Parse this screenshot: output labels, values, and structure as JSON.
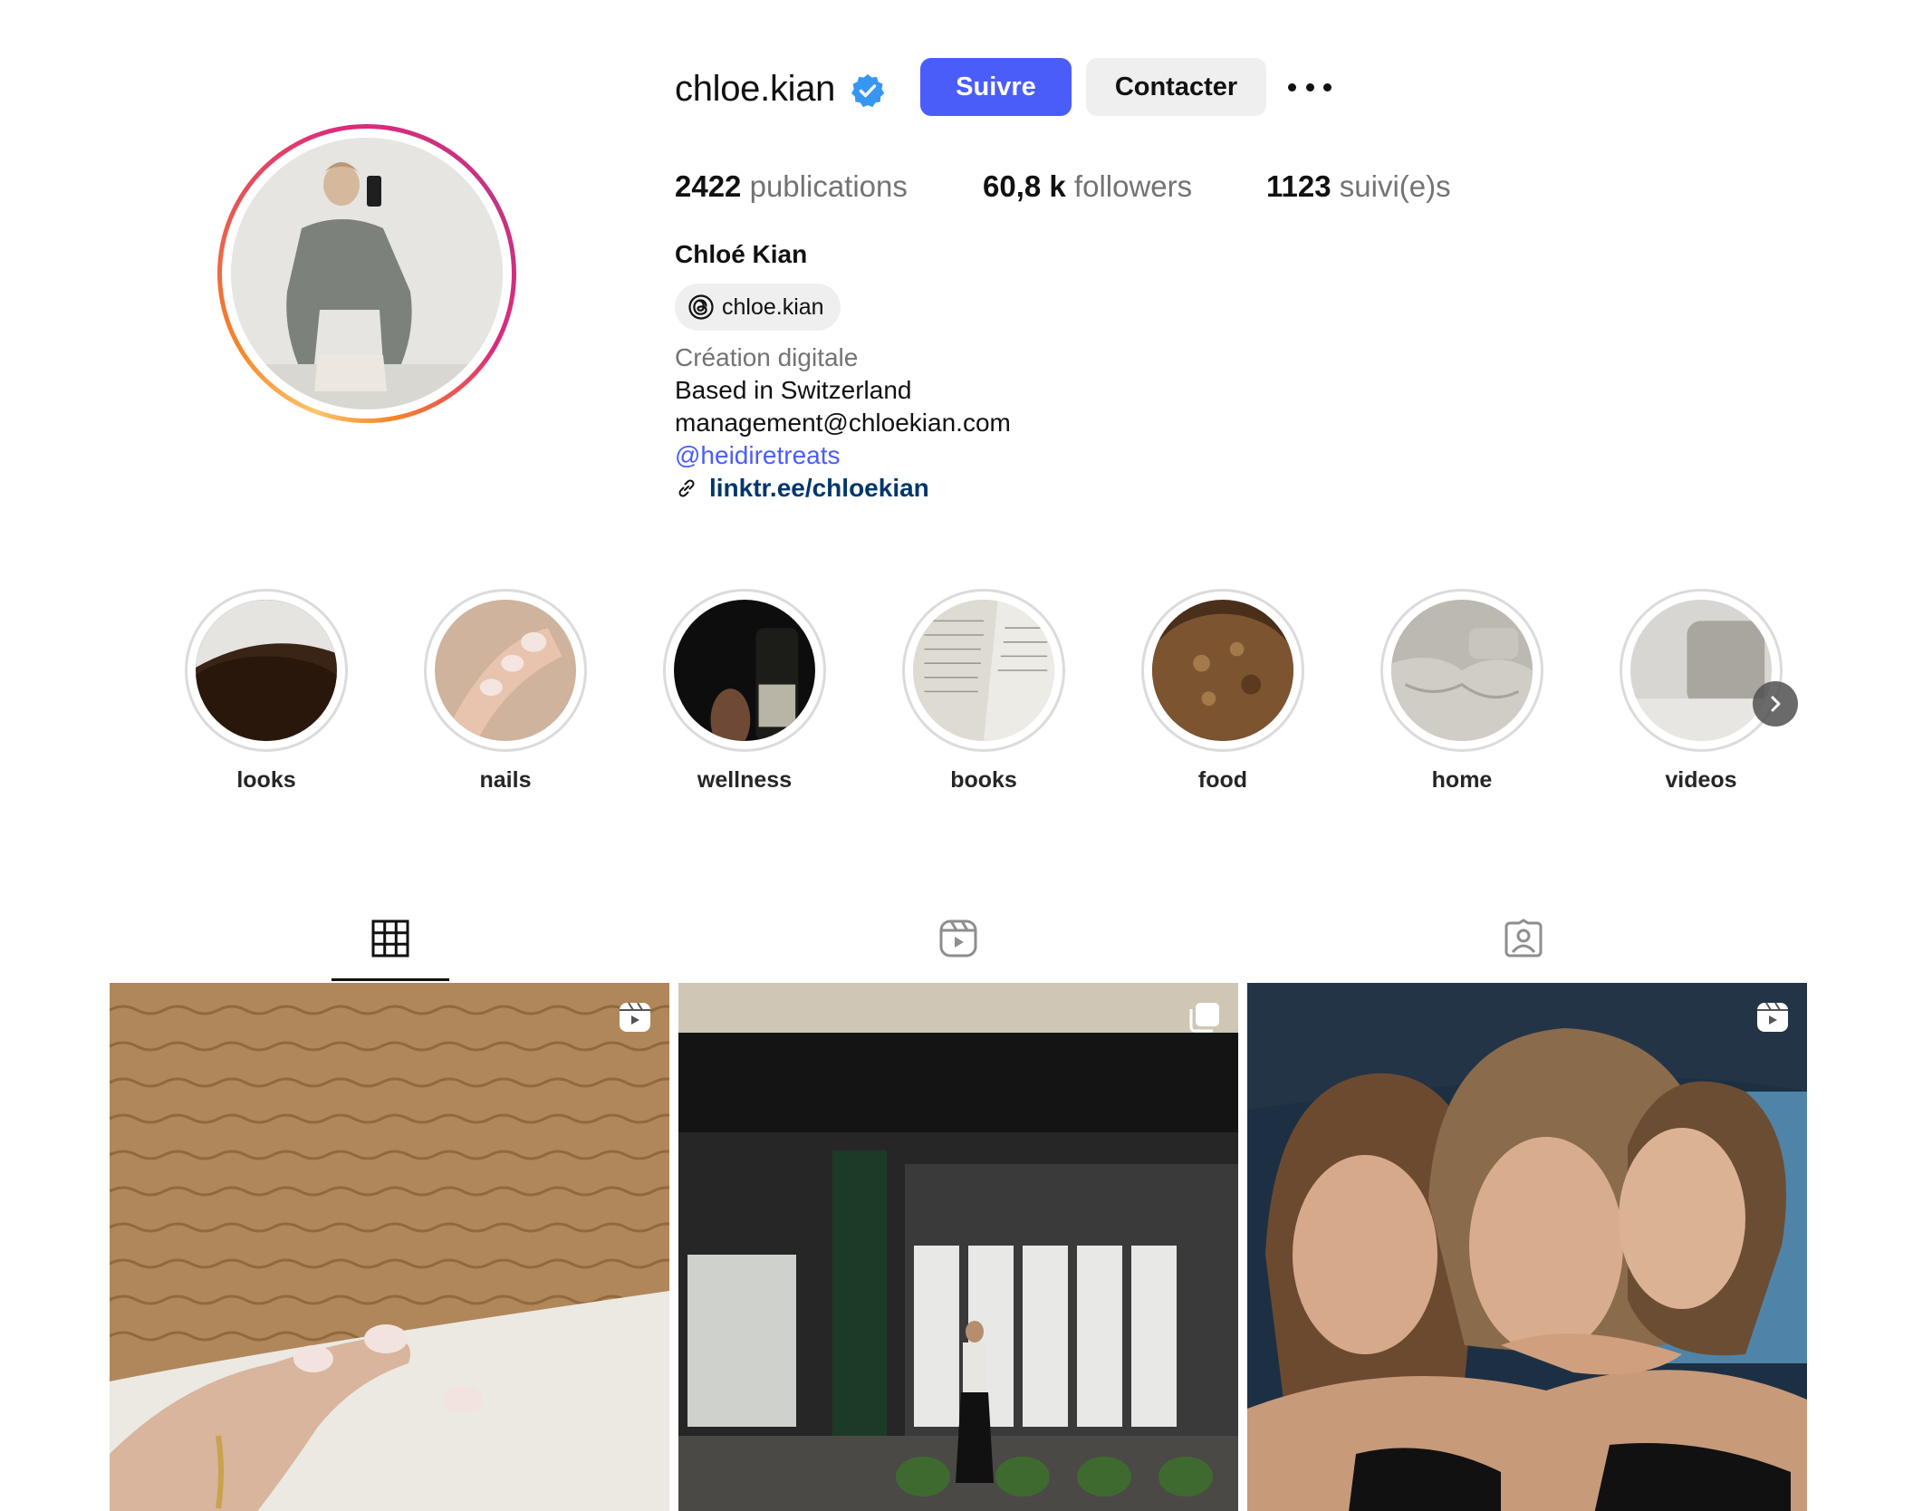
{
  "profile": {
    "username": "chloe.kian",
    "verified_icon": "verified-badge-icon",
    "follow_label": "Suivre",
    "contact_label": "Contacter",
    "more_icon": "more-options-icon",
    "stats": {
      "posts_count": "2422",
      "posts_label": "publications",
      "followers_count": "60,8 k",
      "followers_label": "followers",
      "following_count": "1123",
      "following_label": "suivi(e)s"
    },
    "full_name": "Chloé Kian",
    "threads_handle": "chloe.kian",
    "category": "Création digitale",
    "bio_line1": "Based in Switzerland",
    "bio_line2": "management@chloekian.com",
    "mention": "@heidiretreats",
    "link": "linktr.ee/chloekian"
  },
  "highlights": [
    {
      "label": "looks"
    },
    {
      "label": "nails"
    },
    {
      "label": "wellness"
    },
    {
      "label": "books"
    },
    {
      "label": "food"
    },
    {
      "label": "home"
    },
    {
      "label": "videos"
    }
  ],
  "tabs": [
    {
      "name": "posts",
      "icon": "grid-icon",
      "active": true
    },
    {
      "name": "reels",
      "icon": "reels-icon",
      "active": false
    },
    {
      "name": "tagged",
      "icon": "tagged-icon",
      "active": false
    }
  ],
  "posts": [
    {
      "type": "reel",
      "badge_icon": "reel-icon"
    },
    {
      "type": "carousel",
      "badge_icon": "carousel-icon"
    },
    {
      "type": "reel",
      "badge_icon": "reel-icon"
    }
  ],
  "colors": {
    "accent": "#4a5df9",
    "link": "#00376b",
    "secondary_text": "#737373",
    "button_gray": "#efefef",
    "verified": "#3797f0"
  }
}
